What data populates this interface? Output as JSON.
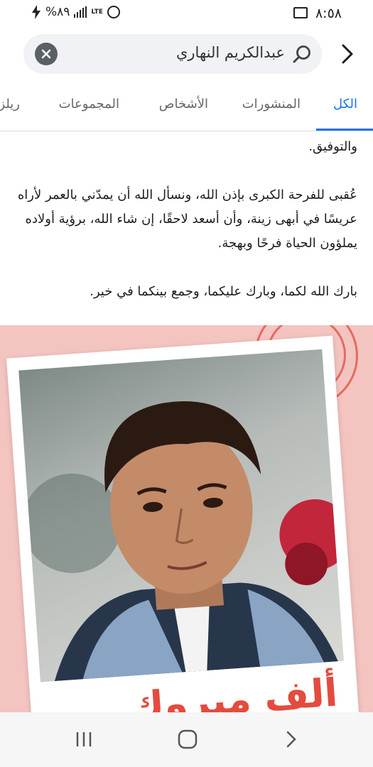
{
  "status_bar": {
    "time": "٨:٥٨",
    "battery": "%٨٩",
    "network": "LTE"
  },
  "search": {
    "query": "عبدالكريم النهاري"
  },
  "tabs": [
    {
      "label": "الكل",
      "active": true
    },
    {
      "label": "المنشورات",
      "active": false
    },
    {
      "label": "الأشخاص",
      "active": false
    },
    {
      "label": "المجموعات",
      "active": false
    },
    {
      "label": "ريلز",
      "active": false
    }
  ],
  "post": {
    "paragraphs": [
      "والتوفيق.",
      "عُقبى للفرحة الكبرى بإذن الله، ونسأل الله أن يمدّني بالعمر لأراه عريسًا في أبهى زينة، وأن أسعد لاحقًا، إن شاء الله، برؤية أولاده يملؤون الحياة فرحًا وبهجة.",
      "بارك الله لكما، وبارك عليكما، وجمع بينكما في خير."
    ],
    "image_caption": "ألف مبروك"
  },
  "colors": {
    "accent": "#1b74e4",
    "image_background": "#f4c4c0",
    "caption_red": "#e44b3f"
  },
  "icons": {
    "back": "chevron-right-icon",
    "search": "search-icon",
    "clear": "close-icon",
    "nav_recent": "recent-apps-icon",
    "nav_home": "home-icon",
    "nav_back": "chevron-right-icon"
  }
}
